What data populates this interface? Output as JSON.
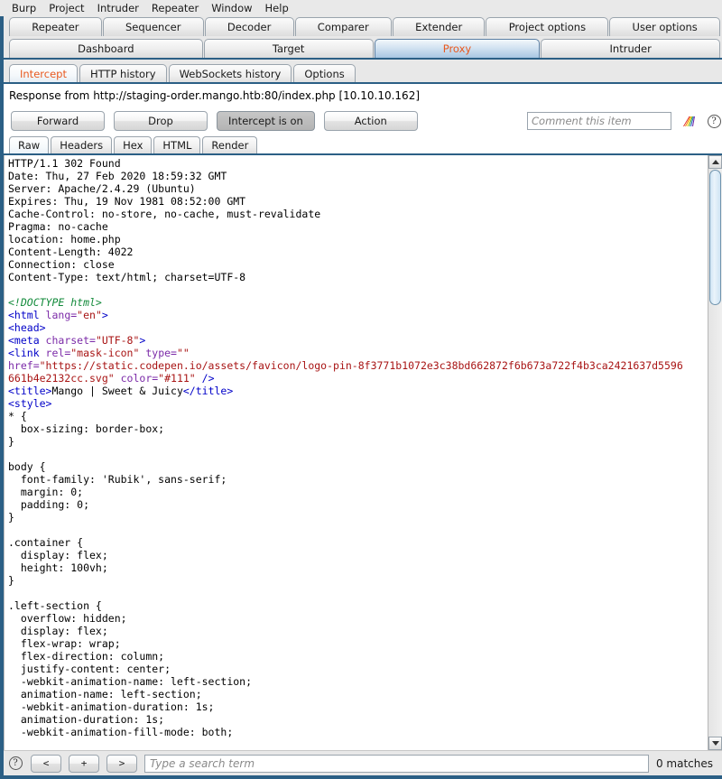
{
  "app": {
    "name": "Burp Suite",
    "accent_color": "#2b5f85",
    "selected_tab_text_color": "#e8591f"
  },
  "menubar": {
    "items": [
      "Burp",
      "Project",
      "Intruder",
      "Repeater",
      "Window",
      "Help"
    ]
  },
  "main_tabs": {
    "row1": [
      {
        "label": "Repeater",
        "selected": false
      },
      {
        "label": "Sequencer",
        "selected": false
      },
      {
        "label": "Decoder",
        "selected": false
      },
      {
        "label": "Comparer",
        "selected": false
      },
      {
        "label": "Extender",
        "selected": false
      },
      {
        "label": "Project options",
        "selected": false
      },
      {
        "label": "User options",
        "selected": false
      }
    ],
    "row2": [
      {
        "label": "Dashboard",
        "selected": false
      },
      {
        "label": "Target",
        "selected": false
      },
      {
        "label": "Proxy",
        "selected": true
      },
      {
        "label": "Intruder",
        "selected": false
      }
    ]
  },
  "proxy_tabs": [
    {
      "label": "Intercept",
      "selected": true
    },
    {
      "label": "HTTP history",
      "selected": false
    },
    {
      "label": "WebSockets history",
      "selected": false
    },
    {
      "label": "Options",
      "selected": false
    }
  ],
  "intercept": {
    "request_line": "Response from http://staging-order.mango.htb:80/index.php  [10.10.10.162]",
    "buttons": [
      {
        "label": "Forward",
        "pressed": false
      },
      {
        "label": "Drop",
        "pressed": false
      },
      {
        "label": "Intercept is on",
        "pressed": true
      },
      {
        "label": "Action",
        "pressed": false
      }
    ],
    "comment_placeholder": "Comment this item",
    "comment_value": "",
    "highlight_icon": "rainbow-highlighter-icon",
    "help_icon": "question-mark-icon"
  },
  "view_tabs": [
    {
      "label": "Raw",
      "selected": true
    },
    {
      "label": "Headers",
      "selected": false
    },
    {
      "label": "Hex",
      "selected": false
    },
    {
      "label": "HTML",
      "selected": false
    },
    {
      "label": "Render",
      "selected": false
    }
  ],
  "message_body": {
    "lines": [
      [
        {
          "t": "HTTP/1.1 302 Found",
          "c": "plain"
        }
      ],
      [
        {
          "t": "Date: Thu, 27 Feb 2020 18:59:32 GMT",
          "c": "plain"
        }
      ],
      [
        {
          "t": "Server: Apache/2.4.29 (Ubuntu)",
          "c": "plain"
        }
      ],
      [
        {
          "t": "Expires: Thu, 19 Nov 1981 08:52:00 GMT",
          "c": "plain"
        }
      ],
      [
        {
          "t": "Cache-Control: no-store, no-cache, must-revalidate",
          "c": "plain"
        }
      ],
      [
        {
          "t": "Pragma: no-cache",
          "c": "plain"
        }
      ],
      [
        {
          "t": "location: home.php",
          "c": "plain"
        }
      ],
      [
        {
          "t": "Content-Length: 4022",
          "c": "plain"
        }
      ],
      [
        {
          "t": "Connection: close",
          "c": "plain"
        }
      ],
      [
        {
          "t": "Content-Type: text/html; charset=UTF-8",
          "c": "plain"
        }
      ],
      [
        {
          "t": "",
          "c": "plain"
        }
      ],
      [
        {
          "t": "<!DOCTYPE html>",
          "c": "comm"
        }
      ],
      [
        {
          "t": "<html",
          "c": "tag"
        },
        {
          "t": " lang=",
          "c": "attr"
        },
        {
          "t": "\"en\"",
          "c": "val"
        },
        {
          "t": ">",
          "c": "tag"
        }
      ],
      [
        {
          "t": "<head>",
          "c": "tag"
        }
      ],
      [
        {
          "t": "<meta",
          "c": "tag"
        },
        {
          "t": " charset=",
          "c": "attr"
        },
        {
          "t": "\"UTF-8\"",
          "c": "val"
        },
        {
          "t": ">",
          "c": "tag"
        }
      ],
      [
        {
          "t": "<link",
          "c": "tag"
        },
        {
          "t": " rel=",
          "c": "attr"
        },
        {
          "t": "\"mask-icon\"",
          "c": "val"
        },
        {
          "t": " type=",
          "c": "attr"
        },
        {
          "t": "\"\"",
          "c": "val"
        }
      ],
      [
        {
          "t": "href=",
          "c": "attr"
        },
        {
          "t": "\"https://static.codepen.io/assets/favicon/logo-pin-8f3771b1072e3c38bd662872f6b673a722f4b3ca2421637d5596",
          "c": "val"
        }
      ],
      [
        {
          "t": "661b4e2132cc.svg\"",
          "c": "val"
        },
        {
          "t": " color=",
          "c": "attr"
        },
        {
          "t": "\"#111\"",
          "c": "val"
        },
        {
          "t": " />",
          "c": "tag"
        }
      ],
      [
        {
          "t": "<title>",
          "c": "tag"
        },
        {
          "t": "Mango | Sweet & Juicy",
          "c": "plain"
        },
        {
          "t": "</title>",
          "c": "tag"
        }
      ],
      [
        {
          "t": "<style>",
          "c": "tag"
        }
      ],
      [
        {
          "t": "* {",
          "c": "plain"
        }
      ],
      [
        {
          "t": "  box-sizing: border-box;",
          "c": "plain"
        }
      ],
      [
        {
          "t": "}",
          "c": "plain"
        }
      ],
      [
        {
          "t": "",
          "c": "plain"
        }
      ],
      [
        {
          "t": "body {",
          "c": "plain"
        }
      ],
      [
        {
          "t": "  font-family: 'Rubik', sans-serif;",
          "c": "plain"
        }
      ],
      [
        {
          "t": "  margin: 0;",
          "c": "plain"
        }
      ],
      [
        {
          "t": "  padding: 0;",
          "c": "plain"
        }
      ],
      [
        {
          "t": "}",
          "c": "plain"
        }
      ],
      [
        {
          "t": "",
          "c": "plain"
        }
      ],
      [
        {
          "t": ".container {",
          "c": "plain"
        }
      ],
      [
        {
          "t": "  display: flex;",
          "c": "plain"
        }
      ],
      [
        {
          "t": "  height: 100vh;",
          "c": "plain"
        }
      ],
      [
        {
          "t": "}",
          "c": "plain"
        }
      ],
      [
        {
          "t": "",
          "c": "plain"
        }
      ],
      [
        {
          "t": ".left-section {",
          "c": "plain"
        }
      ],
      [
        {
          "t": "  overflow: hidden;",
          "c": "plain"
        }
      ],
      [
        {
          "t": "  display: flex;",
          "c": "plain"
        }
      ],
      [
        {
          "t": "  flex-wrap: wrap;",
          "c": "plain"
        }
      ],
      [
        {
          "t": "  flex-direction: column;",
          "c": "plain"
        }
      ],
      [
        {
          "t": "  justify-content: center;",
          "c": "plain"
        }
      ],
      [
        {
          "t": "  -webkit-animation-name: left-section;",
          "c": "plain"
        }
      ],
      [
        {
          "t": "  animation-name: left-section;",
          "c": "plain"
        }
      ],
      [
        {
          "t": "  -webkit-animation-duration: 1s;",
          "c": "plain"
        }
      ],
      [
        {
          "t": "  animation-duration: 1s;",
          "c": "plain"
        }
      ],
      [
        {
          "t": "  -webkit-animation-fill-mode: both;",
          "c": "plain"
        }
      ]
    ]
  },
  "footer": {
    "help_icon": "question-mark-icon",
    "prev_label": "<",
    "add_label": "+",
    "next_label": ">",
    "search_placeholder": "Type a search term",
    "search_value": "",
    "matches_label": "0 matches"
  }
}
